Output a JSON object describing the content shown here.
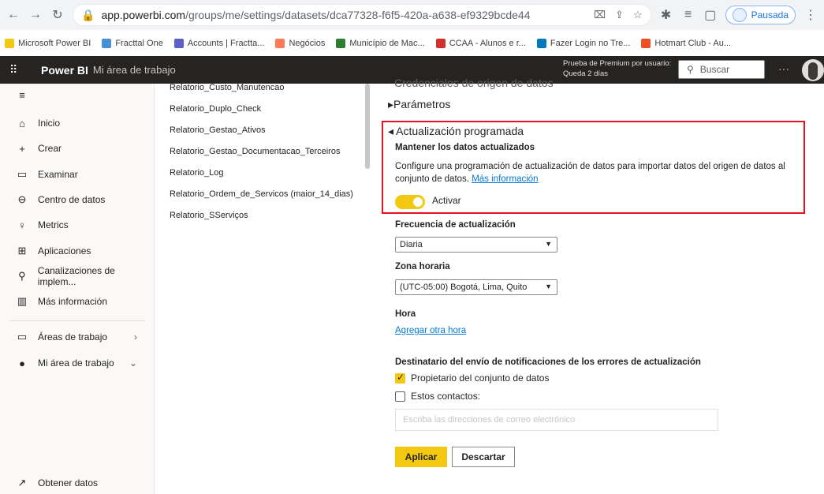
{
  "browser": {
    "url_host": "app.powerbi.com",
    "url_path": "/groups/me/settings/datasets/dca77328-f6f5-420a-a638-ef9329bcde44",
    "profile_label": "Pausada",
    "bookmarks": [
      {
        "label": "Microsoft Power BI",
        "color": "#f2c811"
      },
      {
        "label": "Fracttal One",
        "color": "#4a90d9"
      },
      {
        "label": "Accounts | Fractta...",
        "color": "#5b5fc7"
      },
      {
        "label": "Negócios",
        "color": "#ff7a59"
      },
      {
        "label": "Município de Mac...",
        "color": "#2e7d32"
      },
      {
        "label": "CCAA - Alunos e r...",
        "color": "#d32f2f"
      },
      {
        "label": "Fazer Login no Tre...",
        "color": "#0079bf"
      },
      {
        "label": "Hotmart Club - Au...",
        "color": "#f04e23"
      }
    ]
  },
  "header": {
    "brand": "Power BI",
    "workspace": "Mi área de trabajo",
    "premium_line1": "Prueba de Premium por usuario:",
    "premium_line2": "Queda 2 días",
    "search_placeholder": "Buscar",
    "more": "···"
  },
  "sidebar": {
    "items": [
      {
        "label": "Inicio",
        "icon": "⌂"
      },
      {
        "label": "Crear",
        "icon": "+"
      },
      {
        "label": "Examinar",
        "icon": "▭"
      },
      {
        "label": "Centro de datos",
        "icon": "⊖"
      },
      {
        "label": "Metrics",
        "icon": "♀"
      },
      {
        "label": "Aplicaciones",
        "icon": "⊞"
      },
      {
        "label": "Canalizaciones de implem...",
        "icon": "⚲"
      },
      {
        "label": "Más información",
        "icon": "▥"
      }
    ],
    "workspaces": {
      "label": "Áreas de trabajo",
      "icon": "▭",
      "chevron": "›"
    },
    "my_workspace": {
      "label": "Mi área de trabajo",
      "chevron": "⌄"
    },
    "get_data": {
      "label": "Obtener datos",
      "icon": "↗"
    }
  },
  "datasets": [
    "Relatorio_Custo_Manutencao",
    "Relatorio_Duplo_Check",
    "Relatorio_Gestao_Ativos",
    "Relatorio_Gestao_Documentacao_Terceiros",
    "Relatorio_Log",
    "Relatorio_Ordem_de_Servicos (maior_14_dias)",
    "Relatorio_SServiços"
  ],
  "settings": {
    "cutoff_heading": "Credenciales de origen de datos",
    "params_label": "▸Parámetros",
    "schedule_title": "◂ Actualización programada",
    "keep_updated": "Mantener los datos actualizados",
    "description": "Configure una programación de actualización de datos para importar datos del origen de datos al conjunto de datos.",
    "more_info": "Más información",
    "toggle_label": "Activar",
    "frequency_label": "Frecuencia de actualización",
    "frequency_value": "Diaria",
    "timezone_label": "Zona horaria",
    "timezone_value": "(UTC-05:00) Bogotá, Lima, Quito",
    "time_label": "Hora",
    "add_time": "Agregar otra hora",
    "notify_label": "Destinatario del envío de notificaciones de los errores de actualización",
    "owner_label": "Propietario del conjunto de datos",
    "contacts_label": "Estos contactos:",
    "email_placeholder": "Escriba las direcciones de correo electrónico",
    "apply": "Aplicar",
    "discard": "Descartar"
  }
}
